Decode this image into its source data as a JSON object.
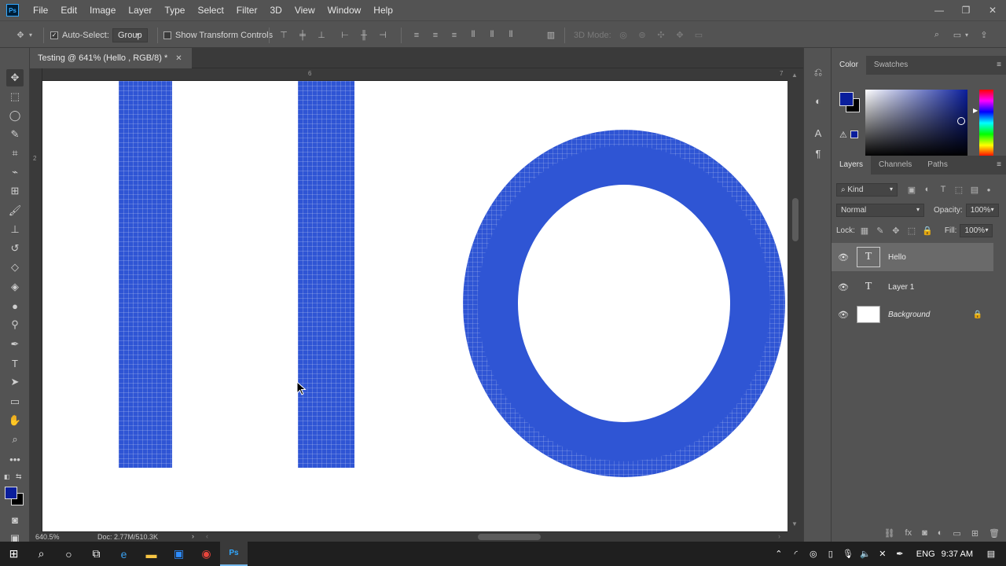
{
  "app": {
    "logo": "Ps"
  },
  "menu": [
    "File",
    "Edit",
    "Image",
    "Layer",
    "Type",
    "Select",
    "Filter",
    "3D",
    "View",
    "Window",
    "Help"
  ],
  "window_controls": {
    "minimize": "—",
    "restore": "❐",
    "close": "✕"
  },
  "options": {
    "auto_select_label": "Auto-Select:",
    "auto_select_value": "Group",
    "show_transform_label": "Show Transform Controls",
    "mode_3d_label": "3D Mode:"
  },
  "document": {
    "tab_title": "Testing @ 641% (Hello , RGB/8) *",
    "ruler_top_labels": [
      "6",
      "7"
    ],
    "ruler_left_labels": [
      "2"
    ]
  },
  "status": {
    "zoom": "640.5%",
    "doc_info": "Doc: 2.77M/510.3K"
  },
  "colors": {
    "foreground": "#0a1e9c",
    "background": "#000000",
    "text_fill": "#2f55d4"
  },
  "color_panel": {
    "tabs": [
      "Color",
      "Swatches"
    ]
  },
  "layers_panel": {
    "tabs": [
      "Layers",
      "Channels",
      "Paths"
    ],
    "filter_kind": "Kind",
    "blend_mode": "Normal",
    "opacity_label": "Opacity:",
    "opacity_value": "100%",
    "lock_label": "Lock:",
    "fill_label": "Fill:",
    "fill_value": "100%",
    "layers": [
      {
        "name": "Hello",
        "type": "text",
        "selected": true
      },
      {
        "name": "Layer 1",
        "type": "text",
        "selected": false
      },
      {
        "name": "Background",
        "type": "image",
        "selected": false,
        "locked": true
      }
    ]
  },
  "taskbar": {
    "lang": "ENG",
    "time": "9:37 AM"
  }
}
